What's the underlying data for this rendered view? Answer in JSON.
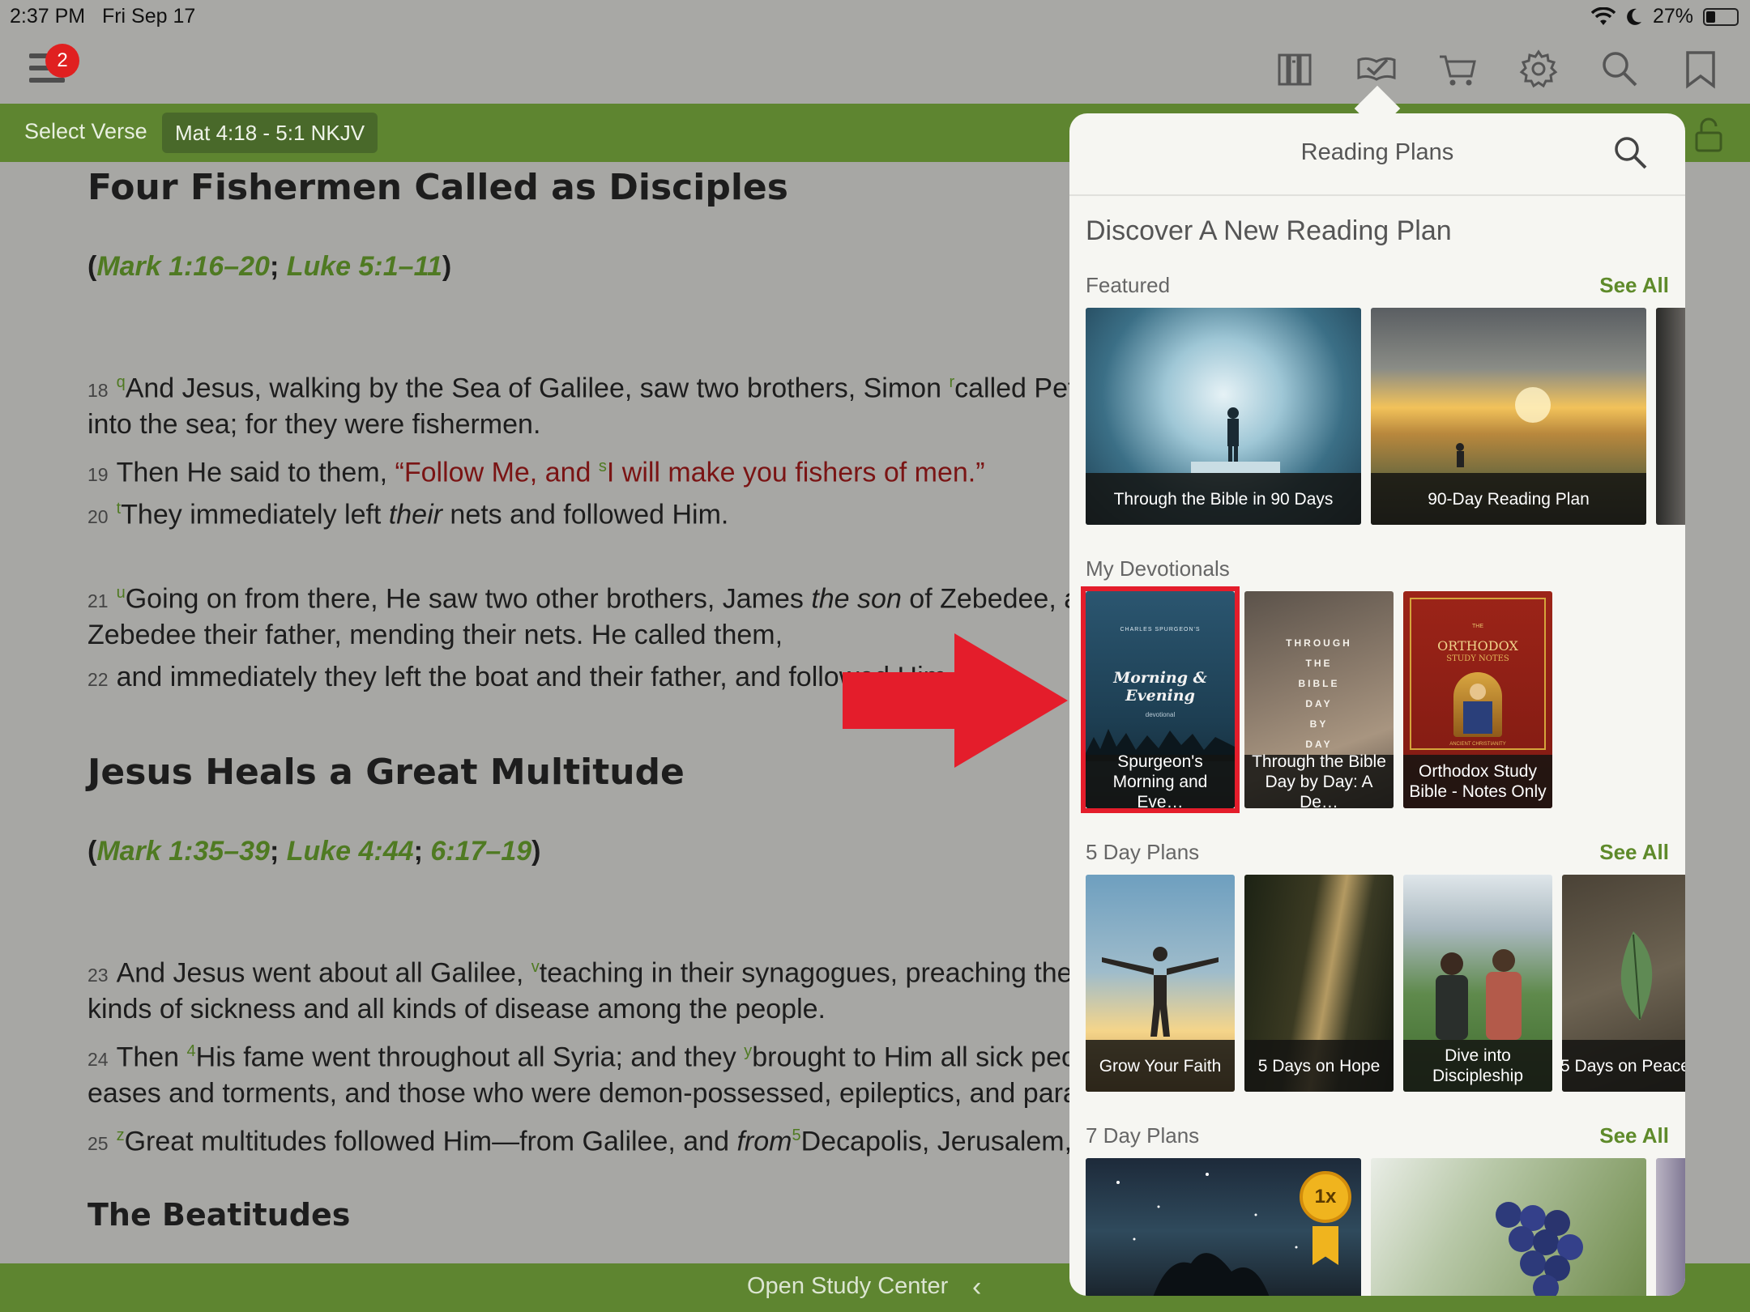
{
  "status_bar": {
    "time": "2:37 PM",
    "date": "Fri Sep 17",
    "battery": "27%"
  },
  "toolbar": {
    "notification_count": "2",
    "icons": [
      "library-icon",
      "reading-plans-icon",
      "cart-icon",
      "gear-icon",
      "search-icon",
      "bookmark-icon"
    ]
  },
  "verse_bar": {
    "select_verse": "Select Verse",
    "reference": "Mat 4:18 - 5:1 NKJV"
  },
  "bible": {
    "heading1": "Four Fishermen Called as Disciples",
    "xref1": {
      "open": "(",
      "a": "Mark 1:16–20",
      "sep": "; ",
      "b": "Luke 5:1–11",
      "close": ")"
    },
    "v18": {
      "num": "18",
      "note": "q",
      "text": "And Jesus, walking by the Sea of Galilee, saw two brothers, Simon ",
      "note2": "r",
      "text2": "called Peter, and Andrew his brother, casting a net"
    },
    "v18b": "into the sea; for they were fishermen.",
    "v19": {
      "num": "19",
      "pre": "Then He said to them, ",
      "red1": "“Follow Me, and ",
      "note": "s",
      "red2": "I will make you fishers of men.”"
    },
    "v20": {
      "num": "20",
      "note": "t",
      "text1": "They immediately left ",
      "ital": "their",
      "text2": " nets and followed Him."
    },
    "v21": {
      "num": "21",
      "note": "u",
      "text1": "Going on from there, He saw two other brothers, James ",
      "ital": "the son",
      "text2": " of Zebedee, and John his brother, in the boat with"
    },
    "v21b": "Zebedee their father, mending their nets. He called them,",
    "v22": {
      "num": "22",
      "text": "and immediately they left the boat and their father, and followed Him."
    },
    "heading2": "Jesus Heals a Great Multitude",
    "xref2": {
      "open": "(",
      "a": "Mark 1:35–39",
      "sep1": "; ",
      "b": "Luke 4:44",
      "sep2": "; ",
      "c": "6:17–19",
      "close": ")"
    },
    "v23": {
      "num": "23",
      "text1": "And Jesus went about all Galilee, ",
      "note": "v",
      "text2": "teaching in their synagogues, preaching the gospel of the kingdom, and healing all"
    },
    "v23b": "kinds of sickness and all kinds of disease among the people.",
    "v24": {
      "num": "24",
      "text1": "Then ",
      "note": "4",
      "text2": "His fame went throughout all Syria; and they ",
      "note2": "y",
      "text3": "brought to Him all sick people who were afflicted with various dis-"
    },
    "v24b": "eases and torments, and those who were demon-possessed, epileptics, and paralytics; and He healed them.",
    "v25": {
      "num": "25",
      "note": "z",
      "text1": "Great multitudes followed Him—from Galilee, and ",
      "ital": "from",
      "note2": "5",
      "text2": "Decapolis, Jerusalem, Judea, and beyond the Jordan."
    },
    "heading3": "The Beatitudes"
  },
  "bottom_bar": {
    "label": "Open Study Center",
    "chevron": "‹"
  },
  "popover": {
    "title": "Reading Plans",
    "discover": "Discover A New Reading Plan",
    "featured": {
      "label": "Featured",
      "see_all": "See All",
      "cards": [
        "Through the Bible in 90 Days",
        "90-Day Reading Plan"
      ]
    },
    "devotionals": {
      "label": "My Devotionals",
      "cards": [
        {
          "line1": "Spurgeon's",
          "line2": "Morning and Eve…"
        },
        {
          "line1": "Through the Bible",
          "line2": "Day by Day: A De…"
        },
        {
          "line1": "Orthodox Study",
          "line2": "Bible - Notes  Only"
        }
      ],
      "covers": {
        "spurgeon_small": "CHARLES SPURGEON'S",
        "spurgeon_title1": "Morning &",
        "spurgeon_title2": "Evening",
        "spurgeon_sub": "devotional",
        "ttb": [
          "THROUGH",
          "THE",
          "BIBLE",
          "DAY",
          "BY",
          "DAY"
        ],
        "osb_the": "THE",
        "osb_title": "ORTHODOX",
        "osb_sub": "STUDY NOTES",
        "osb_bottom": "ANCIENT CHRISTIANITY"
      }
    },
    "five_day": {
      "label": "5 Day Plans",
      "see_all": "See All",
      "cards": [
        {
          "line1": "Grow Your Faith",
          "line2": ""
        },
        {
          "line1": "5 Days on Hope",
          "line2": ""
        },
        {
          "line1": "Dive into",
          "line2": "Discipleship"
        },
        {
          "line1": "5 Days on Peace",
          "line2": ""
        }
      ]
    },
    "seven_day": {
      "label": "7 Day Plans",
      "see_all": "See All",
      "medal": "1x"
    }
  },
  "colors": {
    "green_bar": "#5e8530",
    "link_green": "#4f7a22",
    "words_of_christ": "#7a1414",
    "highlight_red": "#e41d2b"
  }
}
